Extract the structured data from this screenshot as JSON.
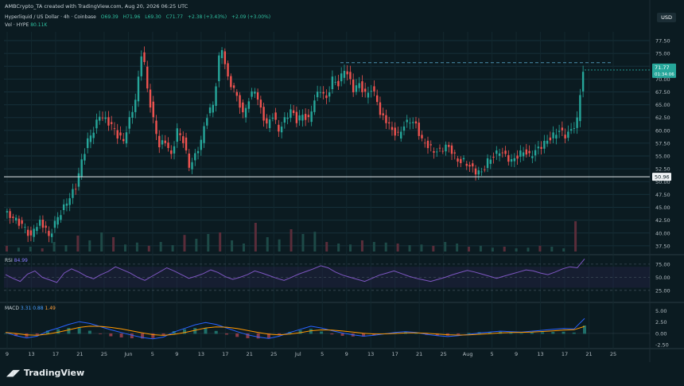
{
  "header": "AMBCrypto_TA created with TradingView.com, Aug 20, 2026 06:25 UTC",
  "symbol": {
    "title": "Hyperliquid / US Dollar · 4h · Coinbase",
    "o": "O69.39",
    "h": "H71.96",
    "l": "L69.30",
    "c": "C71.77",
    "change": "+2.38 (+3.43%)",
    "extra": "+2.09 (+3.00%)"
  },
  "volume": {
    "label": "Vol · HYPE",
    "value": "80.11K"
  },
  "rsi": {
    "label": "RSI",
    "value": "84.99"
  },
  "macd": {
    "label": "MACD",
    "v1": "3.31",
    "v2": "0.88",
    "v3": "1.49"
  },
  "currency": "USD",
  "brand": "TradingView",
  "chart_data": {
    "type": "candlestick",
    "price_axis": {
      "ticks": [
        77.5,
        75.0,
        72.5,
        70.0,
        67.5,
        65.0,
        62.5,
        60.0,
        57.5,
        55.0,
        52.5,
        50.0,
        47.5,
        45.0,
        42.5,
        40.0,
        37.5
      ],
      "ylim": [
        36.4,
        79.2
      ]
    },
    "current_price": "71.77",
    "countdown": "01:34:06",
    "support_level": 50.96,
    "support_label": "50.96",
    "resistance_level": 73.2,
    "x_ticks": [
      "9",
      "13",
      "17",
      "21",
      "25",
      "Jun",
      "5",
      "9",
      "13",
      "17",
      "21",
      "25",
      "Jul",
      "5",
      "9",
      "13",
      "17",
      "21",
      "25",
      "Aug",
      "5",
      "9",
      "13",
      "17",
      "21",
      "25"
    ],
    "close_path": [
      [
        0,
        44
      ],
      [
        3,
        43
      ],
      [
        5,
        42
      ],
      [
        7,
        41
      ],
      [
        9,
        39
      ],
      [
        10,
        41
      ],
      [
        12,
        42
      ],
      [
        14,
        41
      ],
      [
        15,
        39
      ],
      [
        17,
        42
      ],
      [
        20,
        45
      ],
      [
        22,
        47
      ],
      [
        24,
        49
      ],
      [
        26,
        54
      ],
      [
        28,
        58
      ],
      [
        30,
        60
      ],
      [
        32,
        63
      ],
      [
        34,
        62
      ],
      [
        36,
        61
      ],
      [
        38,
        59
      ],
      [
        40,
        58
      ],
      [
        42,
        62
      ],
      [
        44,
        66
      ],
      [
        45,
        70
      ],
      [
        46,
        75
      ],
      [
        47,
        73
      ],
      [
        48,
        68
      ],
      [
        50,
        62
      ],
      [
        52,
        57
      ],
      [
        54,
        58
      ],
      [
        56,
        55
      ],
      [
        58,
        60
      ],
      [
        60,
        58
      ],
      [
        62,
        53
      ],
      [
        64,
        55
      ],
      [
        66,
        58
      ],
      [
        68,
        63
      ],
      [
        70,
        65
      ],
      [
        71,
        69
      ],
      [
        72,
        74
      ],
      [
        73,
        76
      ],
      [
        74,
        73
      ],
      [
        75,
        70
      ],
      [
        77,
        68
      ],
      [
        79,
        65
      ],
      [
        80,
        63
      ],
      [
        82,
        66
      ],
      [
        84,
        68
      ],
      [
        86,
        64
      ],
      [
        88,
        61
      ],
      [
        90,
        63
      ],
      [
        92,
        60
      ],
      [
        94,
        62
      ],
      [
        96,
        64
      ],
      [
        98,
        62
      ],
      [
        100,
        63
      ],
      [
        102,
        62
      ],
      [
        104,
        66
      ],
      [
        106,
        68
      ],
      [
        108,
        66
      ],
      [
        110,
        70
      ],
      [
        112,
        69
      ],
      [
        114,
        72
      ],
      [
        115,
        71
      ],
      [
        117,
        68
      ],
      [
        119,
        69
      ],
      [
        121,
        67
      ],
      [
        123,
        68
      ],
      [
        125,
        66
      ],
      [
        126,
        63
      ],
      [
        128,
        62
      ],
      [
        130,
        60
      ],
      [
        132,
        59
      ],
      [
        134,
        61
      ],
      [
        136,
        62
      ],
      [
        138,
        61
      ],
      [
        140,
        58
      ],
      [
        142,
        57
      ],
      [
        144,
        56
      ],
      [
        146,
        56
      ],
      [
        148,
        57
      ],
      [
        150,
        56
      ],
      [
        152,
        54
      ],
      [
        154,
        54
      ],
      [
        156,
        53
      ],
      [
        158,
        52
      ],
      [
        160,
        51.8
      ],
      [
        162,
        54
      ],
      [
        164,
        55
      ],
      [
        166,
        56
      ],
      [
        168,
        55
      ],
      [
        170,
        54
      ],
      [
        172,
        55
      ],
      [
        174,
        56
      ],
      [
        176,
        55
      ],
      [
        178,
        56
      ],
      [
        180,
        57
      ],
      [
        182,
        58
      ],
      [
        184,
        59
      ],
      [
        186,
        60
      ],
      [
        188,
        59
      ],
      [
        190,
        60
      ],
      [
        192,
        62
      ],
      [
        193,
        67
      ],
      [
        194,
        71.77
      ]
    ],
    "volume_levels": [
      0.18,
      0.12,
      0.15,
      0.1,
      0.3,
      0.2,
      0.5,
      0.35,
      0.6,
      0.45,
      0.22,
      0.28,
      0.18,
      0.3,
      0.2,
      0.52,
      0.4,
      0.55,
      0.6,
      0.35,
      0.25,
      0.9,
      0.45,
      0.38,
      0.7,
      0.55,
      0.62,
      0.3,
      0.25,
      0.22,
      0.35,
      0.3,
      0.28,
      0.25,
      0.2,
      0.22,
      0.18,
      0.3,
      0.25,
      0.15,
      0.18,
      0.12,
      0.15,
      0.1,
      0.12,
      0.18,
      0.15,
      0.1,
      0.95
    ],
    "rsi_axis": {
      "ticks": [
        75.0,
        50.0,
        25.0
      ],
      "ylim": [
        5,
        90
      ]
    },
    "rsi_path": [
      55,
      48,
      42,
      56,
      62,
      50,
      45,
      40,
      58,
      66,
      60,
      52,
      47,
      55,
      61,
      70,
      64,
      58,
      50,
      44,
      52,
      60,
      68,
      62,
      55,
      48,
      52,
      57,
      64,
      59,
      51,
      46,
      50,
      55,
      62,
      58,
      53,
      48,
      44,
      50,
      56,
      61,
      66,
      72,
      68,
      60,
      54,
      50,
      46,
      42,
      48,
      54,
      58,
      62,
      57,
      52,
      48,
      45,
      42,
      46,
      50,
      55,
      59,
      63,
      60,
      56,
      52,
      48,
      52,
      56,
      60,
      64,
      62,
      58,
      55,
      60,
      66,
      70,
      68,
      85
    ],
    "macd_axis": {
      "ticks": [
        5.0,
        2.5,
        0.0,
        -2.5
      ],
      "ylim": [
        -3,
        6.5
      ]
    },
    "macd_path": [
      0.2,
      -0.5,
      -1.0,
      -0.6,
      0.5,
      1.2,
      2.0,
      2.6,
      2.2,
      1.5,
      0.8,
      0.2,
      -0.4,
      -0.9,
      -1.2,
      -0.8,
      0.3,
      1.1,
      1.9,
      2.4,
      2.0,
      1.2,
      0.4,
      -0.3,
      -0.8,
      -1.1,
      -0.6,
      0.2,
      0.9,
      1.6,
      1.2,
      0.6,
      0.1,
      -0.3,
      -0.6,
      -0.4,
      -0.1,
      0.2,
      0.4,
      0.2,
      -0.2,
      -0.5,
      -0.7,
      -0.5,
      -0.2,
      0.1,
      0.3,
      0.5,
      0.4,
      0.3,
      0.5,
      0.7,
      0.9,
      1.1,
      1.0,
      3.31
    ],
    "colors": {
      "up": "#26a69a",
      "down": "#ef5350",
      "rsi": "#7e57c2",
      "signal": "#ff9800",
      "macd": "#2962ff",
      "price_label": "#26a69a"
    }
  }
}
